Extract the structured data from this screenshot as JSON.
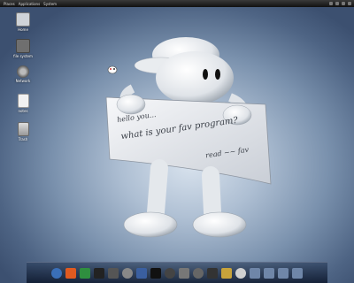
{
  "menubar": {
    "items": [
      "Places",
      "Applications",
      "System"
    ],
    "right_items": [
      "net",
      "vol",
      "mail",
      "clock"
    ]
  },
  "desktop_icons": [
    {
      "label": "Home",
      "icon": "computer-icon",
      "color": "#cfd3d8"
    },
    {
      "label": "file system",
      "icon": "drive-icon",
      "color": "#6f6f6f"
    },
    {
      "label": "Network",
      "icon": "network-icon",
      "color": "#8a8a8a"
    },
    {
      "label": "notes",
      "icon": "document-icon",
      "color": "#f2f2f2"
    },
    {
      "label": "Trash",
      "icon": "trash-icon",
      "color": "#b9b9b9"
    }
  ],
  "sign": {
    "line1": "hello you...",
    "line2": "what is your fav program?",
    "line3": "read ~~ fav"
  },
  "dock": {
    "icons": [
      "globe-icon",
      "fox-icon",
      "chat-icon",
      "terminal-icon",
      "gear-icon",
      "eye-icon",
      "feather-icon",
      "screen-icon",
      "disc-icon",
      "photo-icon",
      "sync-icon",
      "gear2-icon",
      "star-icon",
      "power-icon",
      "monitor-icon",
      "monitor-icon-2",
      "monitor-icon-3",
      "monitor-icon-4"
    ],
    "colors": [
      "#3a6fb8",
      "#e05a20",
      "#2f8f3f",
      "#222",
      "#555",
      "#888",
      "#3a5fa0",
      "#111",
      "#444",
      "#777",
      "#666",
      "#333",
      "#c7a33b",
      "#d0d0d0",
      "#6f86a8",
      "#6f86a8",
      "#6f86a8",
      "#6f86a8"
    ]
  }
}
